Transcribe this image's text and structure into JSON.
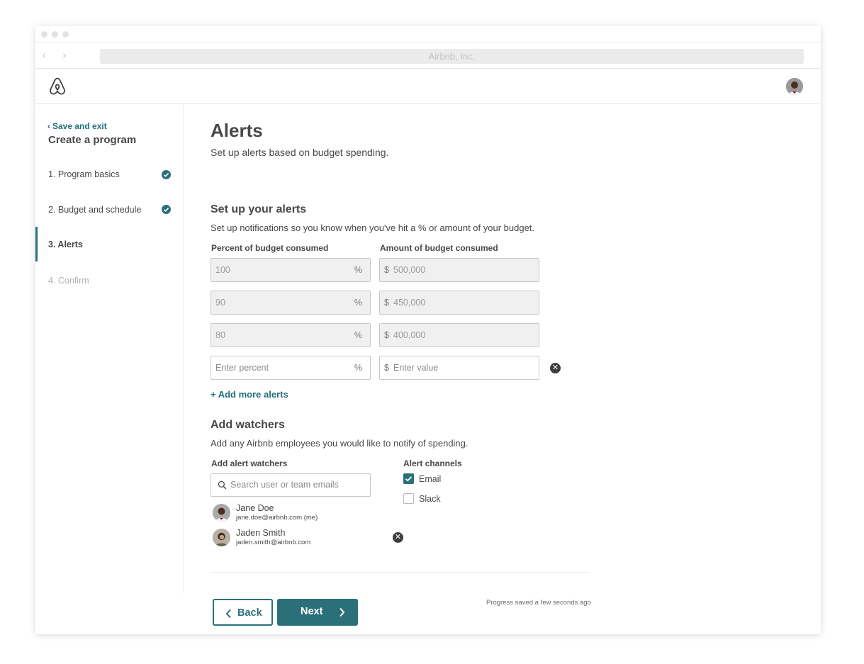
{
  "browser": {
    "url_text": "Airbnb, Inc."
  },
  "sidebar": {
    "save_exit": "Save and exit",
    "title": "Create a program",
    "steps": [
      {
        "label": "1. Program basics",
        "completed": true
      },
      {
        "label": "2. Budget and schedule",
        "completed": true
      },
      {
        "label": "3. Alerts",
        "active": true
      },
      {
        "label": "4. Confirm",
        "disabled": true
      }
    ]
  },
  "main": {
    "title": "Alerts",
    "subtitle": "Set up alerts based on budget spending.",
    "alerts_section": {
      "title": "Set up your alerts",
      "description": "Set up notifications so you know when you've hit a % or amount of your budget.",
      "percent_header": "Percent of budget consumed",
      "amount_header": "Amount of budget consumed",
      "rows": [
        {
          "percent": "100",
          "amount": "500,000"
        },
        {
          "percent": "90",
          "amount": "450,000"
        },
        {
          "percent": "80",
          "amount": "400,000"
        }
      ],
      "percent_placeholder": "Enter percent",
      "amount_placeholder": "Enter value",
      "percent_suffix": "%",
      "currency_prefix": "$",
      "add_more": "+ Add more alerts"
    },
    "watchers_section": {
      "title": "Add watchers",
      "description": "Add any Airbnb employees you would like to notify of spending.",
      "watchers_label": "Add alert watchers",
      "search_placeholder": "Search user or team emails",
      "watchers": [
        {
          "name": "Jane Doe",
          "email": "jane.doe@airbnb.com (me)"
        },
        {
          "name": "Jaden Smith",
          "email": "jaden.smith@airbnb.com"
        }
      ],
      "channels_label": "Alert channels",
      "channels": [
        {
          "label": "Email",
          "checked": true
        },
        {
          "label": "Slack",
          "checked": false
        }
      ]
    },
    "footer": {
      "back": "Back",
      "next": "Next",
      "progress_note": "Progress saved a few seconds ago"
    }
  },
  "colors": {
    "accent": "#2b7079",
    "link": "#1f6f78",
    "text": "#484848",
    "logo": "#3d3d3d"
  }
}
